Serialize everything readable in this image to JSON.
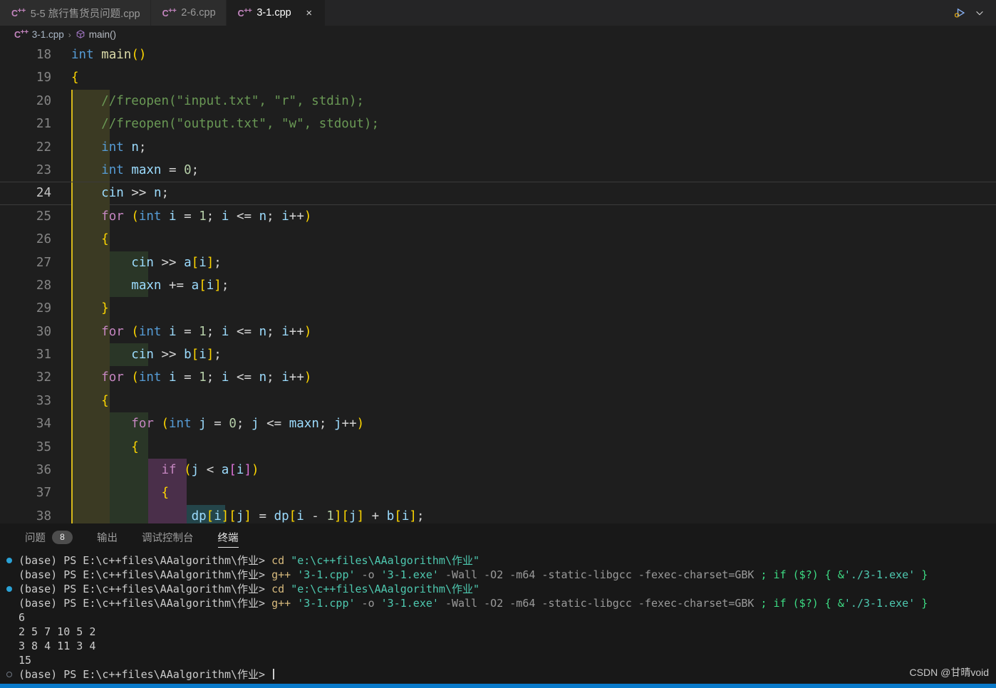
{
  "window": {
    "tabs": [
      {
        "label": "5-5 旅行售货员问题.cpp",
        "icon": "cpp-file-icon",
        "active": false,
        "closable": false
      },
      {
        "label": "2-6.cpp",
        "icon": "cpp-file-icon",
        "active": false,
        "closable": false
      },
      {
        "label": "3-1.cpp",
        "icon": "cpp-file-icon",
        "active": true,
        "closable": true,
        "close_label": "×"
      }
    ],
    "actions": [
      {
        "name": "run-and-debug-icon",
        "label": ""
      },
      {
        "name": "chevron-down-icon",
        "label": ""
      }
    ]
  },
  "breadcrumb": {
    "file_icon": "cpp-file-icon",
    "file": "3-1.cpp",
    "separator": "›",
    "symbol_icon": "symbol-method-icon",
    "symbol": "main()"
  },
  "editor": {
    "first_line": 18,
    "current_line": 24,
    "lines": [
      {
        "n": 18,
        "indent": 0,
        "text": "int main()"
      },
      {
        "n": 19,
        "indent": 0,
        "text": "{"
      },
      {
        "n": 20,
        "indent": 1,
        "text": "//freopen(\"input.txt\", \"r\", stdin);"
      },
      {
        "n": 21,
        "indent": 1,
        "text": "//freopen(\"output.txt\", \"w\", stdout);"
      },
      {
        "n": 22,
        "indent": 1,
        "text": "int n;"
      },
      {
        "n": 23,
        "indent": 1,
        "text": "int maxn = 0;"
      },
      {
        "n": 24,
        "indent": 1,
        "text": "cin >> n;"
      },
      {
        "n": 25,
        "indent": 1,
        "text": "for (int i = 1; i <= n; i++)"
      },
      {
        "n": 26,
        "indent": 1,
        "text": "{"
      },
      {
        "n": 27,
        "indent": 2,
        "text": "cin >> a[i];"
      },
      {
        "n": 28,
        "indent": 2,
        "text": "maxn += a[i];"
      },
      {
        "n": 29,
        "indent": 1,
        "text": "}"
      },
      {
        "n": 30,
        "indent": 1,
        "text": "for (int i = 1; i <= n; i++)"
      },
      {
        "n": 31,
        "indent": 2,
        "text": "cin >> b[i];"
      },
      {
        "n": 32,
        "indent": 1,
        "text": "for (int i = 1; i <= n; i++)"
      },
      {
        "n": 33,
        "indent": 1,
        "text": "{"
      },
      {
        "n": 34,
        "indent": 2,
        "text": "for (int j = 0; j <= maxn; j++)"
      },
      {
        "n": 35,
        "indent": 2,
        "text": "{"
      },
      {
        "n": 36,
        "indent": 3,
        "text": "if (j < a[i])"
      },
      {
        "n": 37,
        "indent": 3,
        "text": "{"
      },
      {
        "n": 38,
        "indent": 4,
        "text": "dp[i][j] = dp[i - 1][j] + b[i];"
      }
    ]
  },
  "panel": {
    "tabs": [
      {
        "label": "问题",
        "badge": "8",
        "active": false
      },
      {
        "label": "输出",
        "badge": "",
        "active": false
      },
      {
        "label": "调试控制台",
        "badge": "",
        "active": false
      },
      {
        "label": "终端",
        "badge": "",
        "active": true
      }
    ],
    "terminal": {
      "prompt_prefix": "(base) PS E:\\c++files\\AAalgorithm\\作业>",
      "lines": [
        {
          "deco": "filled",
          "type": "prompt",
          "cmd": "cd",
          "args": " \"e:\\c++files\\AAalgorithm\\作业\""
        },
        {
          "deco": "none",
          "type": "prompt",
          "cmd": "g++",
          "args": " '3-1.cpp' -o '3-1.exe' -Wall -O2 -m64 -static-libgcc -fexec-charset=GBK ; if ($?) { &'./3-1.exe' }"
        },
        {
          "deco": "filled",
          "type": "prompt",
          "cmd": "cd",
          "args": " \"e:\\c++files\\AAalgorithm\\作业\""
        },
        {
          "deco": "none",
          "type": "prompt",
          "cmd": "g++",
          "args": " '3-1.cpp' -o '3-1.exe' -Wall -O2 -m64 -static-libgcc -fexec-charset=GBK ; if ($?) { &'./3-1.exe' }"
        },
        {
          "deco": "none",
          "type": "output",
          "text": "6"
        },
        {
          "deco": "none",
          "type": "output",
          "text": "2 5 7 10 5 2"
        },
        {
          "deco": "none",
          "type": "output",
          "text": "3 8 4 11 3 4"
        },
        {
          "deco": "none",
          "type": "output",
          "text": "15"
        },
        {
          "deco": "hollow",
          "type": "prompt-cursor",
          "cmd": "",
          "args": ""
        }
      ]
    }
  },
  "watermark": {
    "text": "CSDN @甘晴void"
  },
  "colors": {
    "editor_background": "#1e1e1e",
    "tabbar_background": "#252526",
    "panel_background": "#181818",
    "accent": "#0a7aca",
    "comment": "#6a9955",
    "keyword": "#569cd6",
    "control_keyword": "#c586c0",
    "string": "#ce9178",
    "number": "#b5cea8",
    "variable": "#9cdcfe",
    "bracket_l0": "#ffd700",
    "bracket_l1": "#da70d6",
    "bracket_l2": "#179fff",
    "badge_background": "#4d4d4d"
  }
}
